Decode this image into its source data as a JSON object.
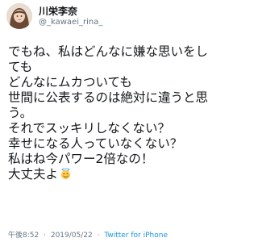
{
  "user": {
    "display_name": "川栄李奈",
    "handle": "@_kawaei_rina_"
  },
  "tweet": {
    "lines": [
      "でもね、私はどんなに嫌な思いをし",
      "ても",
      "どんなにムカついても",
      "世間に公表するのは絶対に違うと思",
      "う。",
      "それでスッキリしなくない？",
      "幸せになる人っていなくない？",
      "私はね今パワー2倍なの！",
      "大丈夫よ"
    ],
    "emoji": "smiling-face-with-halo-icon"
  },
  "footer": {
    "time": "午後8:52",
    "date": "2019/05/22",
    "separator": "·",
    "source": "Twitter for iPhone"
  },
  "colors": {
    "text": "#14171a",
    "muted": "#657786",
    "link": "#1b95e0"
  }
}
